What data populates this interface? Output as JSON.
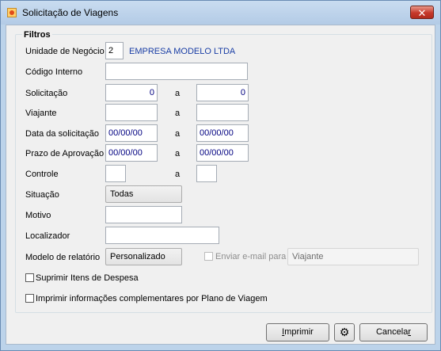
{
  "window": {
    "title": "Solicitação de Viagens",
    "close_label": "✕"
  },
  "filters": {
    "legend": "Filtros",
    "business_unit": {
      "label": "Unidade de Negócio",
      "code": "2",
      "name": "EMPRESA MODELO LTDA"
    },
    "internal_code": {
      "label": "Código Interno",
      "value": ""
    },
    "request": {
      "label": "Solicitação",
      "from": "0",
      "sep": "a",
      "to": "0"
    },
    "traveler": {
      "label": "Viajante",
      "from": "",
      "sep": "a",
      "to": ""
    },
    "request_date": {
      "label": "Data da solicitação",
      "from": "00/00/00",
      "sep": "a",
      "to": "00/00/00"
    },
    "approval_deadline": {
      "label": "Prazo de Aprovação",
      "from": "00/00/00",
      "sep": "a",
      "to": "00/00/00"
    },
    "control": {
      "label": "Controle",
      "from": "",
      "sep": "a",
      "to": ""
    },
    "status": {
      "label": "Situação",
      "selected": "Todas"
    },
    "reason": {
      "label": "Motivo",
      "value": ""
    },
    "locator": {
      "label": "Localizador",
      "value": ""
    },
    "report_model": {
      "label": "Modelo de relatório",
      "selected": "Personalizado"
    },
    "send_email": {
      "label": "Enviar e-mail para",
      "checked": false,
      "enabled": false,
      "selected": "Viajante"
    },
    "suppress_expense_items": {
      "label": "Suprimir Itens de Despesa",
      "checked": false
    },
    "print_complementary": {
      "label": "Imprimir informações complementares por Plano de Viagem",
      "checked": false
    }
  },
  "buttons": {
    "print_underline": "I",
    "print_rest": "mprimir",
    "settings_icon": "⚙",
    "cancel_prefix": "Cancela",
    "cancel_underline": "r"
  },
  "colors": {
    "window_frame": "#bcd3ea",
    "client_bg": "#f0f0f0",
    "value_text": "#000080",
    "company_text": "#1a3ea5"
  }
}
